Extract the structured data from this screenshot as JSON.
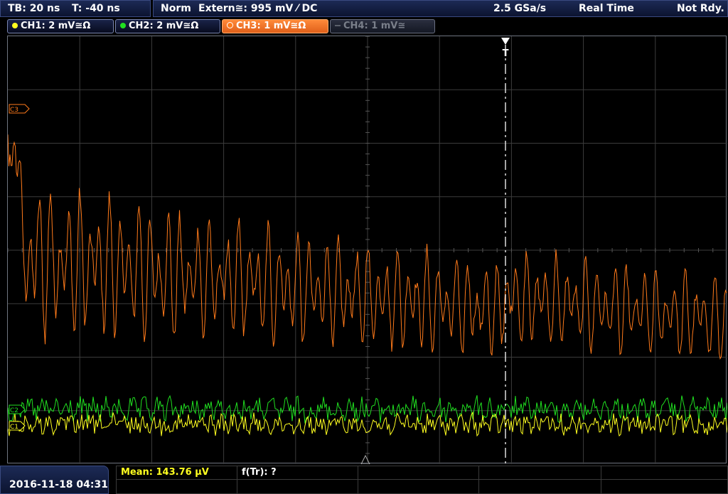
{
  "timebase": {
    "tb": "TB: 20 ns",
    "trigger_time": "T: -40 ns"
  },
  "status": {
    "mode": "Norm",
    "trigger_source": "Extern≅: 995 mV ⁄ DC",
    "sample_rate": "2.5 GSa/s",
    "acquisition": "Real Time",
    "state": "Not Rdy."
  },
  "channels": [
    {
      "label": "CH1: 2 mV≅Ω",
      "color": "#ffff20",
      "active": true
    },
    {
      "label": "CH2: 2 mV≅Ω",
      "color": "#20e020",
      "active": true
    },
    {
      "label": "CH3: 1 mV≅Ω",
      "color": "#ff7a1a",
      "active": true,
      "selected": true
    },
    {
      "label": "CH4: 1 mV≅",
      "color": "#6a6f7a",
      "active": false
    }
  ],
  "markers": {
    "ch3": "C3",
    "ch2": "C2",
    "ch1": "C1",
    "trigger": "T"
  },
  "datetime": "2016-11-18 04:31",
  "measurements": {
    "mean": "Mean: 143.76 µV",
    "freq": "f(Tr): ?"
  },
  "colors": {
    "ch1": "#ffff20",
    "ch2": "#20e020",
    "ch3": "#ff7a1a",
    "grid": "#3c3c3c",
    "panel": "#0c1430"
  }
}
